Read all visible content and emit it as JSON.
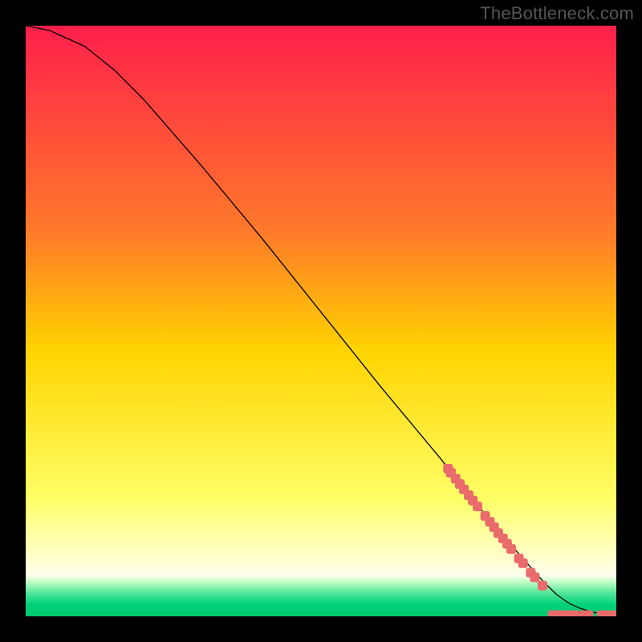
{
  "attribution": "TheBottleneck.com",
  "gradient": {
    "hard_stops": [
      {
        "percent": 0,
        "color": "#ff1f4b"
      },
      {
        "percent": 35,
        "color": "#ff7a2a"
      },
      {
        "percent": 55,
        "color": "#ffd400"
      },
      {
        "percent": 80,
        "color": "#ffff66"
      },
      {
        "percent": 90,
        "color": "#ffffcc"
      },
      {
        "percent": 93,
        "color": "#ffffee"
      },
      {
        "percent": 94,
        "color": "#ccffcc"
      },
      {
        "percent": 96,
        "color": "#55e69a"
      },
      {
        "percent": 98,
        "color": "#00d27a"
      },
      {
        "percent": 100,
        "color": "#00c86e"
      }
    ]
  },
  "curve": {
    "color": "#000000",
    "width": 1.3,
    "points": [
      {
        "x": 0.0,
        "y": 100.0
      },
      {
        "x": 0.04,
        "y": 99.2
      },
      {
        "x": 0.1,
        "y": 96.5
      },
      {
        "x": 0.15,
        "y": 92.5
      },
      {
        "x": 0.2,
        "y": 87.5
      },
      {
        "x": 0.3,
        "y": 76.0
      },
      {
        "x": 0.4,
        "y": 64.0
      },
      {
        "x": 0.5,
        "y": 51.5
      },
      {
        "x": 0.6,
        "y": 39.0
      },
      {
        "x": 0.7,
        "y": 27.0
      },
      {
        "x": 0.78,
        "y": 17.0
      },
      {
        "x": 0.84,
        "y": 10.0
      },
      {
        "x": 0.88,
        "y": 5.5
      },
      {
        "x": 0.9,
        "y": 3.6
      },
      {
        "x": 0.92,
        "y": 2.2
      },
      {
        "x": 0.94,
        "y": 1.3
      },
      {
        "x": 0.96,
        "y": 0.7
      },
      {
        "x": 0.98,
        "y": 0.35
      },
      {
        "x": 1.0,
        "y": 0.2
      }
    ]
  },
  "markers": {
    "color": "#e96b6b",
    "rx": 6,
    "ry": 6,
    "corner": 3,
    "diagonal_cluster": [
      {
        "x": 0.715,
        "y": 25.0
      },
      {
        "x": 0.72,
        "y": 24.3
      },
      {
        "x": 0.728,
        "y": 23.3
      },
      {
        "x": 0.735,
        "y": 22.4
      },
      {
        "x": 0.742,
        "y": 21.5
      },
      {
        "x": 0.75,
        "y": 20.5
      },
      {
        "x": 0.757,
        "y": 19.6
      },
      {
        "x": 0.765,
        "y": 18.6
      },
      {
        "x": 0.778,
        "y": 17.0
      },
      {
        "x": 0.786,
        "y": 16.0
      },
      {
        "x": 0.793,
        "y": 15.1
      },
      {
        "x": 0.8,
        "y": 14.1
      },
      {
        "x": 0.808,
        "y": 13.2
      },
      {
        "x": 0.815,
        "y": 12.3
      },
      {
        "x": 0.822,
        "y": 11.4
      },
      {
        "x": 0.835,
        "y": 9.8
      },
      {
        "x": 0.842,
        "y": 9.0
      },
      {
        "x": 0.855,
        "y": 7.4
      },
      {
        "x": 0.862,
        "y": 6.6
      },
      {
        "x": 0.875,
        "y": 5.2
      }
    ],
    "bottom_cluster": [
      {
        "x": 0.892,
        "y": 0.2
      },
      {
        "x": 0.9,
        "y": 0.2
      },
      {
        "x": 0.908,
        "y": 0.2
      },
      {
        "x": 0.915,
        "y": 0.2
      },
      {
        "x": 0.922,
        "y": 0.2
      },
      {
        "x": 0.93,
        "y": 0.2
      },
      {
        "x": 0.945,
        "y": 0.2
      },
      {
        "x": 0.953,
        "y": 0.2
      },
      {
        "x": 0.975,
        "y": 0.2
      },
      {
        "x": 0.983,
        "y": 0.2
      },
      {
        "x": 0.998,
        "y": 0.2
      }
    ]
  },
  "chart_data": {
    "type": "line",
    "title": "",
    "xlabel": "",
    "ylabel": "",
    "xlim": [
      0,
      1
    ],
    "ylim": [
      0,
      100
    ],
    "grid": false,
    "legend": false,
    "series": [
      {
        "name": "curve",
        "x": [
          0.0,
          0.04,
          0.1,
          0.15,
          0.2,
          0.3,
          0.4,
          0.5,
          0.6,
          0.7,
          0.78,
          0.84,
          0.88,
          0.9,
          0.92,
          0.94,
          0.96,
          0.98,
          1.0
        ],
        "y": [
          100.0,
          99.2,
          96.5,
          92.5,
          87.5,
          76.0,
          64.0,
          51.5,
          39.0,
          27.0,
          17.0,
          10.0,
          5.5,
          3.6,
          2.2,
          1.3,
          0.7,
          0.35,
          0.2
        ]
      },
      {
        "name": "markers-diagonal",
        "x": [
          0.715,
          0.72,
          0.728,
          0.735,
          0.742,
          0.75,
          0.757,
          0.765,
          0.778,
          0.786,
          0.793,
          0.8,
          0.808,
          0.815,
          0.822,
          0.835,
          0.842,
          0.855,
          0.862,
          0.875
        ],
        "y": [
          25.0,
          24.3,
          23.3,
          22.4,
          21.5,
          20.5,
          19.6,
          18.6,
          17.0,
          16.0,
          15.1,
          14.1,
          13.2,
          12.3,
          11.4,
          9.8,
          9.0,
          7.4,
          6.6,
          5.2
        ]
      },
      {
        "name": "markers-bottom",
        "x": [
          0.892,
          0.9,
          0.908,
          0.915,
          0.922,
          0.93,
          0.945,
          0.953,
          0.975,
          0.983,
          0.998
        ],
        "y": [
          0.2,
          0.2,
          0.2,
          0.2,
          0.2,
          0.2,
          0.2,
          0.2,
          0.2,
          0.2,
          0.2
        ]
      }
    ],
    "background_gradient_vertical_pct": [
      {
        "pct": 0,
        "color": "#ff1f4b"
      },
      {
        "pct": 35,
        "color": "#ff7a2a"
      },
      {
        "pct": 55,
        "color": "#ffd400"
      },
      {
        "pct": 80,
        "color": "#ffff66"
      },
      {
        "pct": 90,
        "color": "#ffffcc"
      },
      {
        "pct": 93,
        "color": "#ffffee"
      },
      {
        "pct": 94,
        "color": "#ccffcc"
      },
      {
        "pct": 96,
        "color": "#55e69a"
      },
      {
        "pct": 98,
        "color": "#00d27a"
      },
      {
        "pct": 100,
        "color": "#00c86e"
      }
    ]
  }
}
